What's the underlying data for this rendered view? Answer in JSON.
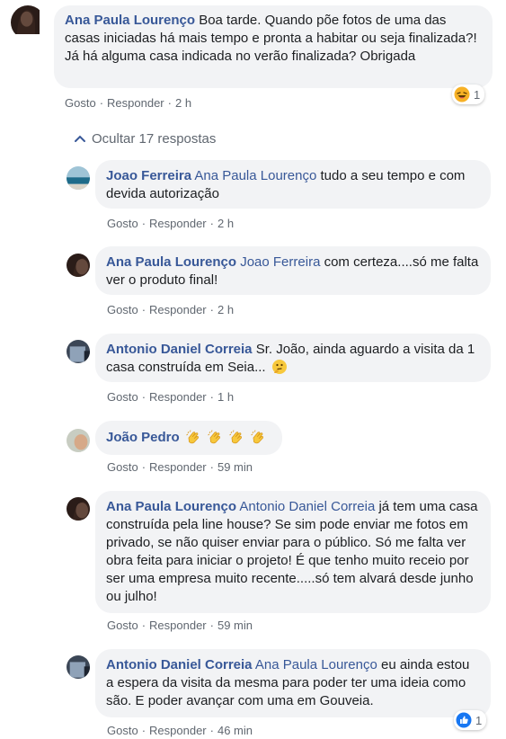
{
  "comments": [
    {
      "author": "Ana Paula Lourenço",
      "mention": "",
      "text": "Boa tarde. Quando põe fotos de uma das casas iniciadas há mais tempo e pronta a habitar ou seja finalizada?! Já há alguma casa indicada no verão finalizada? Obrigada",
      "like": "Gosto",
      "reply": "Responder",
      "time": "2 h",
      "reaction_count": "1",
      "reaction_icon": "haha-icon"
    },
    {
      "author": "Joao Ferreira",
      "mention": "Ana Paula Lourenço",
      "text": "tudo a seu tempo e com devida autorização",
      "like": "Gosto",
      "reply": "Responder",
      "time": "2 h"
    },
    {
      "author": "Ana Paula Lourenço",
      "mention": "Joao Ferreira",
      "text": "com certeza....só me falta ver o produto final!",
      "like": "Gosto",
      "reply": "Responder",
      "time": "2 h"
    },
    {
      "author": "Antonio Daniel Correia",
      "mention": "",
      "text": "Sr. João, ainda aguardo a visita da 1 casa construída em Seia...",
      "emoji": "thinking-face-icon",
      "like": "Gosto",
      "reply": "Responder",
      "time": "1 h"
    },
    {
      "author": "João Pedro",
      "mention": "",
      "text": "",
      "emoji": "clapping-hands-icon",
      "like": "Gosto",
      "reply": "Responder",
      "time": "59 min"
    },
    {
      "author": "Ana Paula Lourenço",
      "mention": "Antonio Daniel Correia",
      "text": "já tem uma casa construída pela line house? Se sim pode enviar me fotos em privado, se não quiser enviar para o público. Só me falta ver obra feita para iniciar o projeto! É que tenho muito receio por ser uma empresa muito recente.....só tem alvará desde junho ou julho!",
      "like": "Gosto",
      "reply": "Responder",
      "time": "59 min"
    },
    {
      "author": "Antonio Daniel Correia",
      "mention": "Ana Paula Lourenço",
      "text": "eu ainda estou a espera da visita da mesma para poder ter uma ideia como são. E poder avançar com uma em Gouveia.",
      "like": "Gosto",
      "reply": "Responder",
      "time": "46 min",
      "reaction_count": "1",
      "reaction_icon": "like-icon"
    }
  ],
  "hide_replies_label": "Ocultar 17 respostas",
  "colors": {
    "link": "#385898",
    "bubble": "#f2f3f5",
    "meta": "#606770",
    "like_blue": "#1877f2",
    "haha_yellow": "#f7b125"
  }
}
